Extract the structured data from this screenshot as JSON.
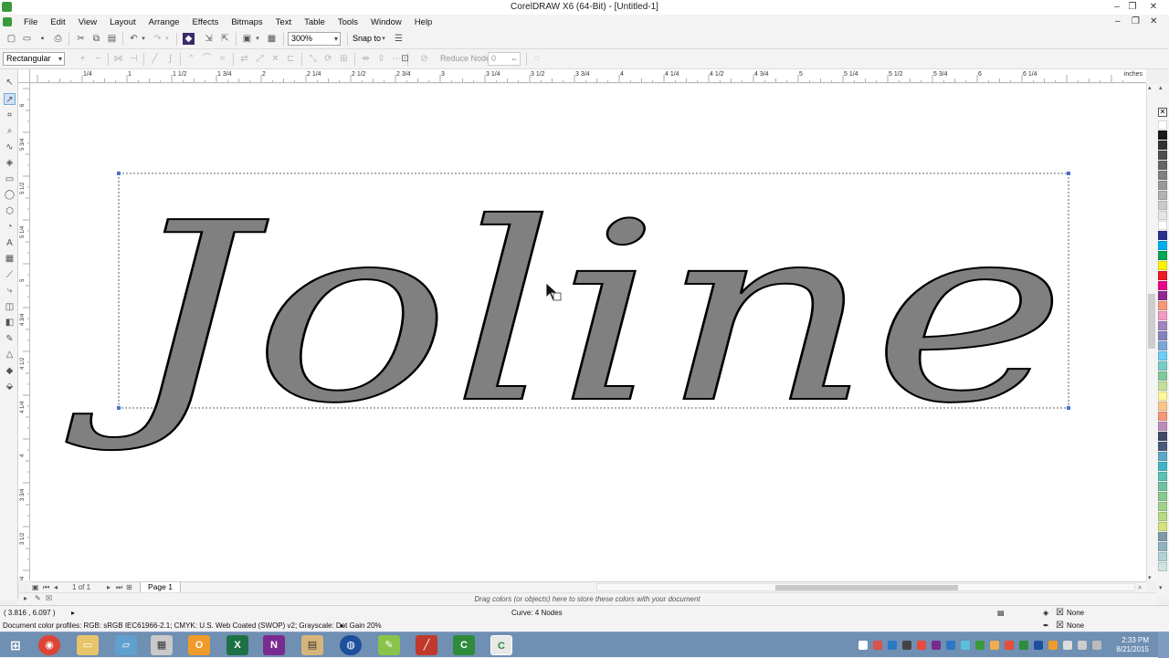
{
  "window": {
    "title": "CorelDRAW X6 (64-Bit) - [Untitled-1]",
    "controls": {
      "minimize": "–",
      "maximize": "❐",
      "close": "✕"
    }
  },
  "menu": [
    "File",
    "Edit",
    "View",
    "Layout",
    "Arrange",
    "Effects",
    "Bitmaps",
    "Text",
    "Table",
    "Tools",
    "Window",
    "Help"
  ],
  "standard_toolbar": {
    "zoom_value": "300%",
    "snap_to_label": "Snap to"
  },
  "property_bar": {
    "selection_mode": "Rectangular",
    "reduce_nodes_label": "Reduce Nodes",
    "reduce_nodes_value": "0"
  },
  "rulers": {
    "unit": "inches",
    "h_labels": [
      "1/4",
      "1",
      "1 1/2",
      "1 3/4",
      "2",
      "2 1/4",
      "2 1/2",
      "2 3/4",
      "3",
      "3 1/4",
      "3 1/2",
      "3 3/4",
      "4",
      "4 1/4",
      "4 1/2",
      "4 3/4",
      "5",
      "5 1/4",
      "5 1/2",
      "5 3/4",
      "6",
      "6 1/4"
    ],
    "v_labels": [
      "6",
      "5 3/4",
      "5 1/2",
      "5 1/4",
      "5",
      "4 3/4",
      "4 1/2",
      "4 1/4",
      "4",
      "3 3/4",
      "3 1/2",
      "3 1/4"
    ]
  },
  "canvas": {
    "artwork_text": "Joline",
    "fill_color": "#808080",
    "outline_color": "#000000"
  },
  "page_navigation": {
    "page_count": "1 of 1",
    "page_tab": "Page 1"
  },
  "document_palette": {
    "hint": "Drag colors (or objects) here to store these colors with your document"
  },
  "status": {
    "coordinates": "( 3.816 , 6.097 )",
    "object_info": "Curve: 4 Nodes",
    "color_profiles": "Document color profiles: RGB: sRGB IEC61966-2.1; CMYK: U.S. Web Coated (SWOP) v2; Grayscale: Dot Gain 20%",
    "fill": "None",
    "outline": "None"
  },
  "palette_colors": [
    "#ffffff",
    "#1a1a1a",
    "#333333",
    "#4d4d4d",
    "#666666",
    "#808080",
    "#999999",
    "#b3b3b3",
    "#cccccc",
    "#e6e6e6",
    "#ffffff",
    "#2e3192",
    "#00aeef",
    "#00a651",
    "#fff200",
    "#ed1c24",
    "#ec008c",
    "#92278f",
    "#f7977a",
    "#f49ac2",
    "#a186be",
    "#8781bd",
    "#7ea7d8",
    "#6dcff6",
    "#7accc8",
    "#82ca9c",
    "#c4df9b",
    "#fff799",
    "#fdc689",
    "#f69679",
    "#bd8cbf",
    "#3f4a6b",
    "#4a5a7a",
    "#5aa9c9",
    "#3fb6c8",
    "#5cc1b4",
    "#6ec2a0",
    "#86c890",
    "#a1d28b",
    "#b8da85",
    "#d1e27e",
    "#7f9aa8",
    "#91b3bf",
    "#b0d4d6",
    "#cce6df"
  ],
  "taskbar": {
    "time": "2:33 PM",
    "date": "8/21/2015"
  }
}
